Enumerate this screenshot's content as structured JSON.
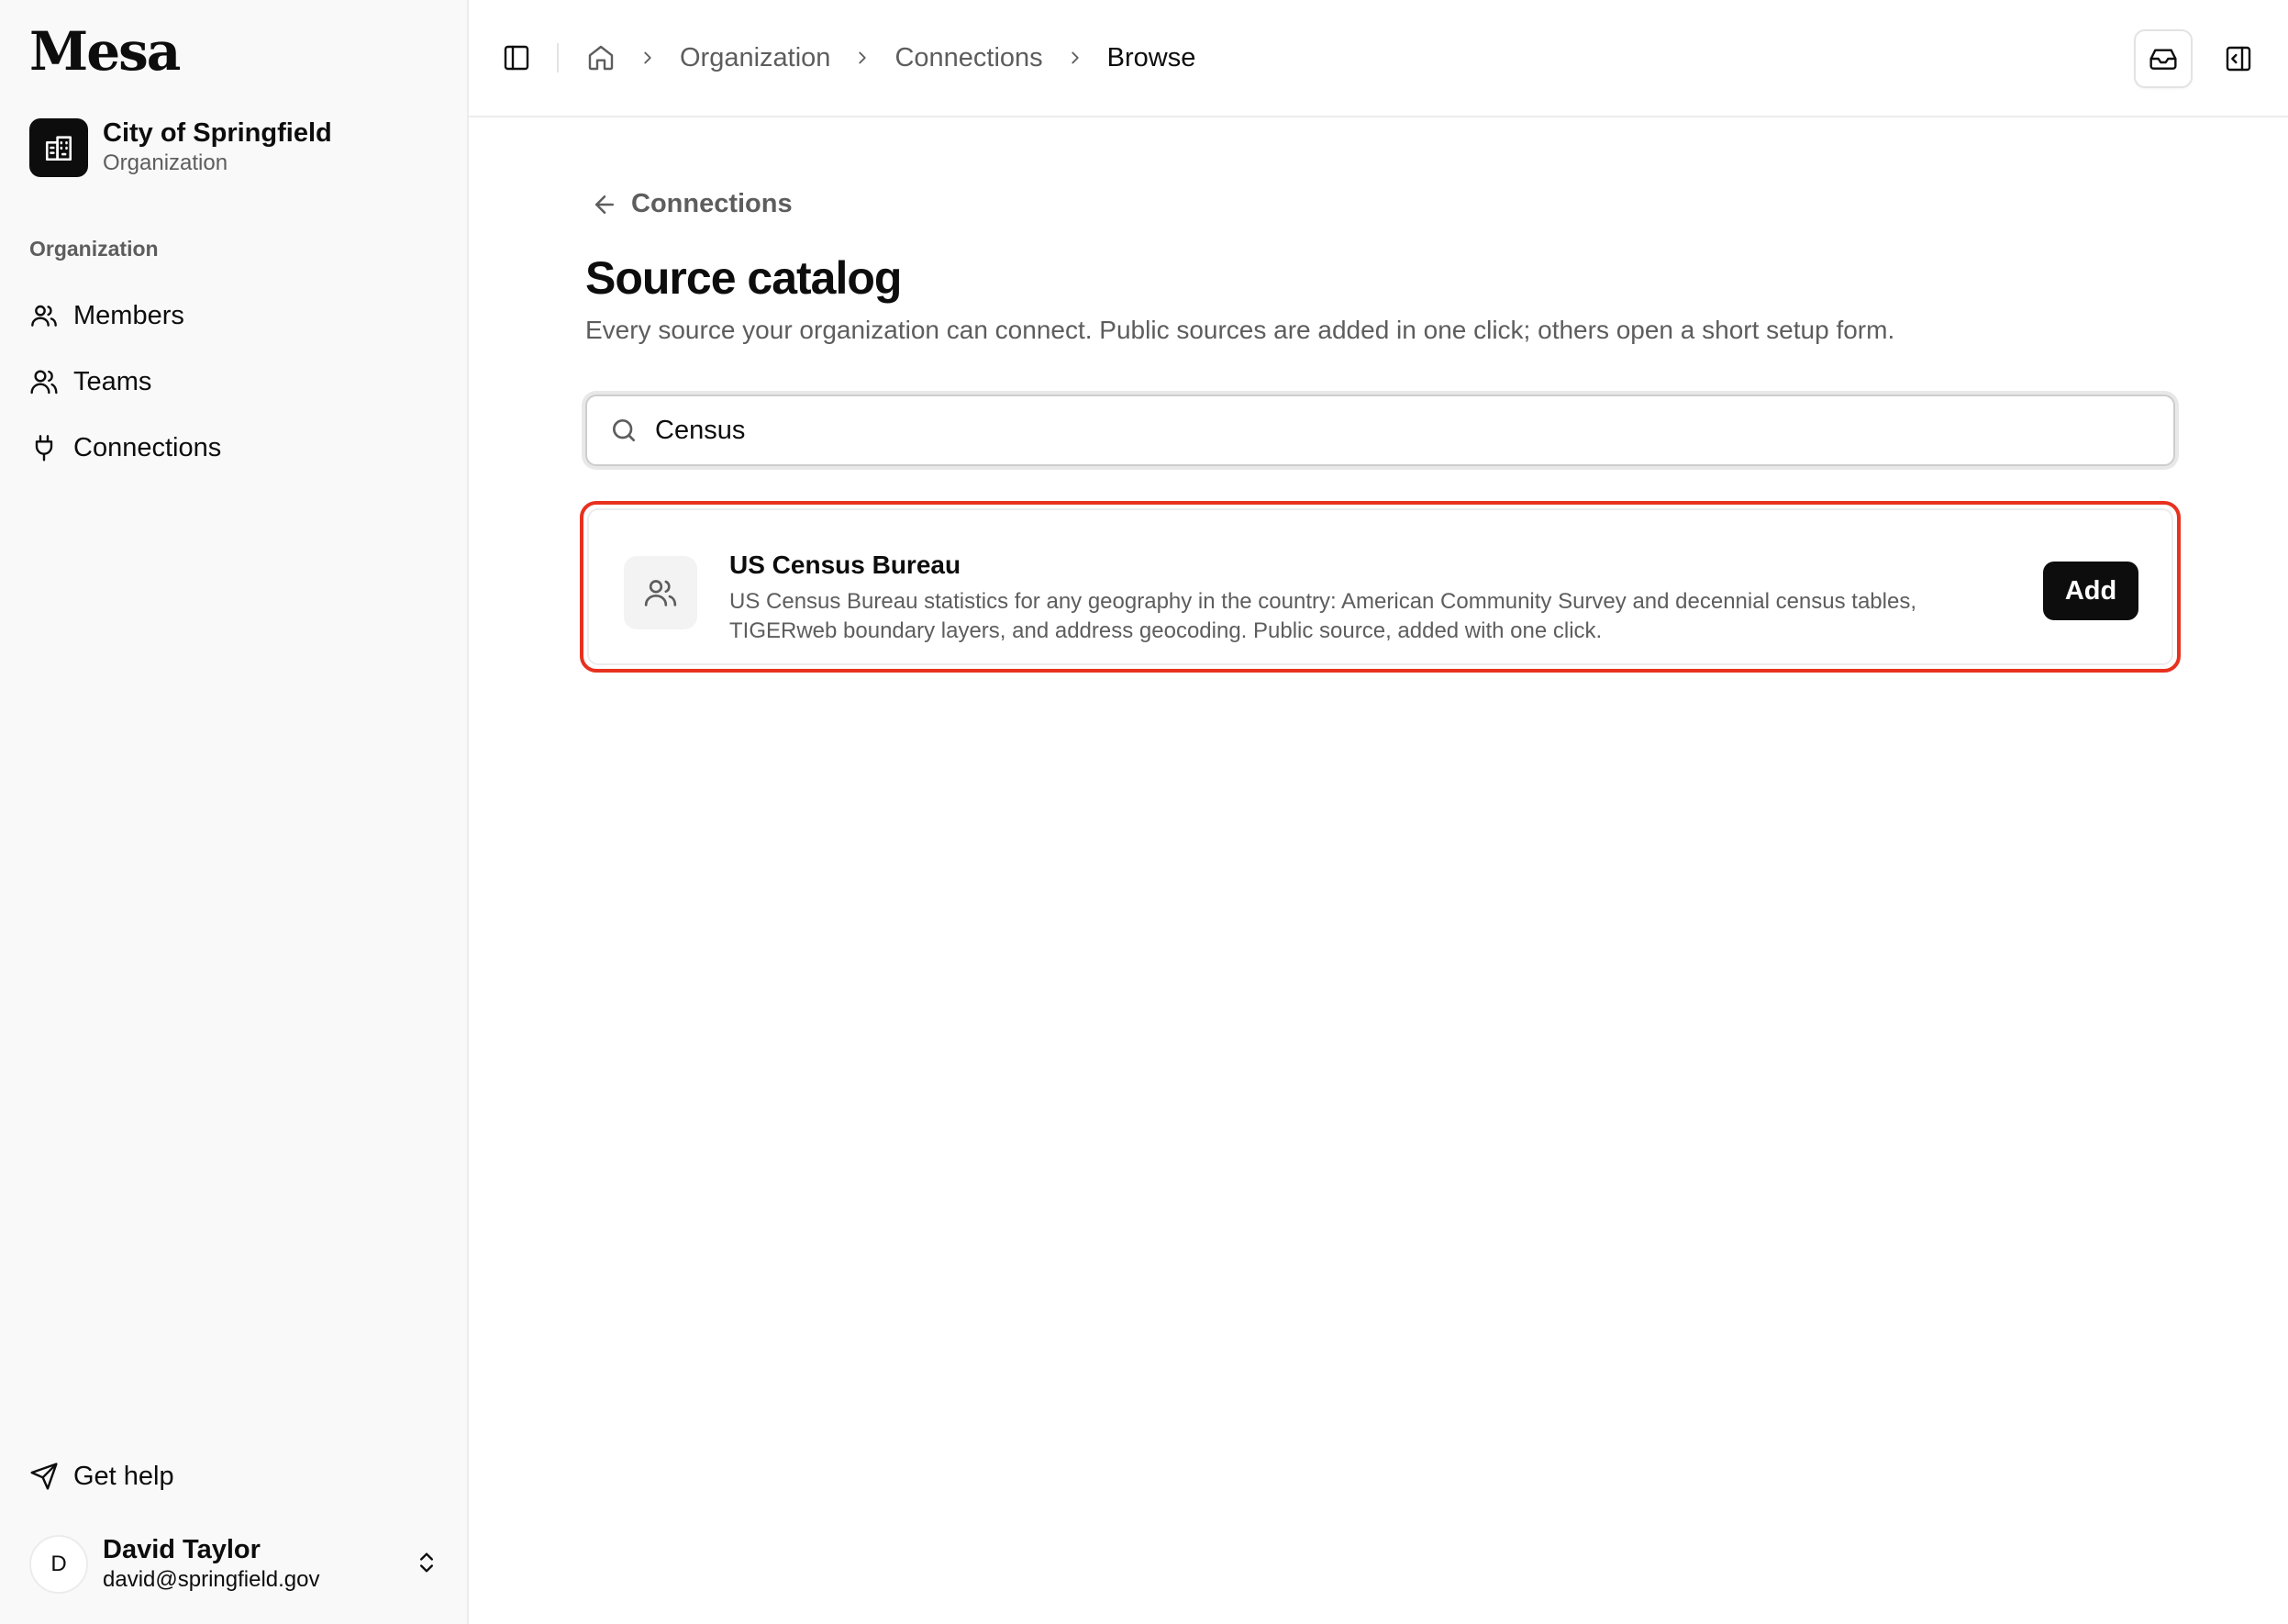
{
  "app": {
    "logo": "Mesa"
  },
  "org": {
    "name": "City of Springfield",
    "type": "Organization"
  },
  "sidebar": {
    "section_label": "Organization",
    "items": [
      {
        "label": "Members",
        "icon": "members-icon"
      },
      {
        "label": "Teams",
        "icon": "teams-icon"
      },
      {
        "label": "Connections",
        "icon": "plug-icon"
      }
    ],
    "help_label": "Get help"
  },
  "user": {
    "initial": "D",
    "name": "David Taylor",
    "email": "david@springfield.gov"
  },
  "breadcrumb": [
    "Organization",
    "Connections",
    "Browse"
  ],
  "page": {
    "back_label": "Connections",
    "title": "Source catalog",
    "description": "Every source your organization can connect. Public sources are added in one click; others open a short setup form."
  },
  "search": {
    "value": "Census"
  },
  "results": [
    {
      "name": "US Census Bureau",
      "description": "US Census Bureau statistics for any geography in the country: American Community Survey and decennial census tables, TIGERweb boundary layers, and address geocoding. Public source, added with one click.",
      "action_label": "Add"
    }
  ],
  "colors": {
    "highlight": "#e8311e",
    "primary": "#0d0d0d",
    "muted": "#5d5d5d"
  }
}
